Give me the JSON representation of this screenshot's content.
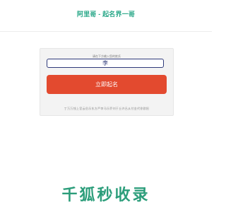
{
  "header": {
    "title": "阿里哥 - 起名界一哥"
  },
  "form": {
    "hint": "请在下方输入您的姓氏",
    "surname_value": "李",
    "submit_label": "立即起名",
    "footnote": "丁万万钱上官云岳乐东方严李马乐乔刘于丘许吕从付金代徐欧阳"
  },
  "watermark": {
    "text": "千狐秒收录"
  },
  "colors": {
    "title": "#2aa889",
    "button": "#e34a2f",
    "input_border": "#2f3a7a",
    "watermark": "#2b9d7a"
  }
}
